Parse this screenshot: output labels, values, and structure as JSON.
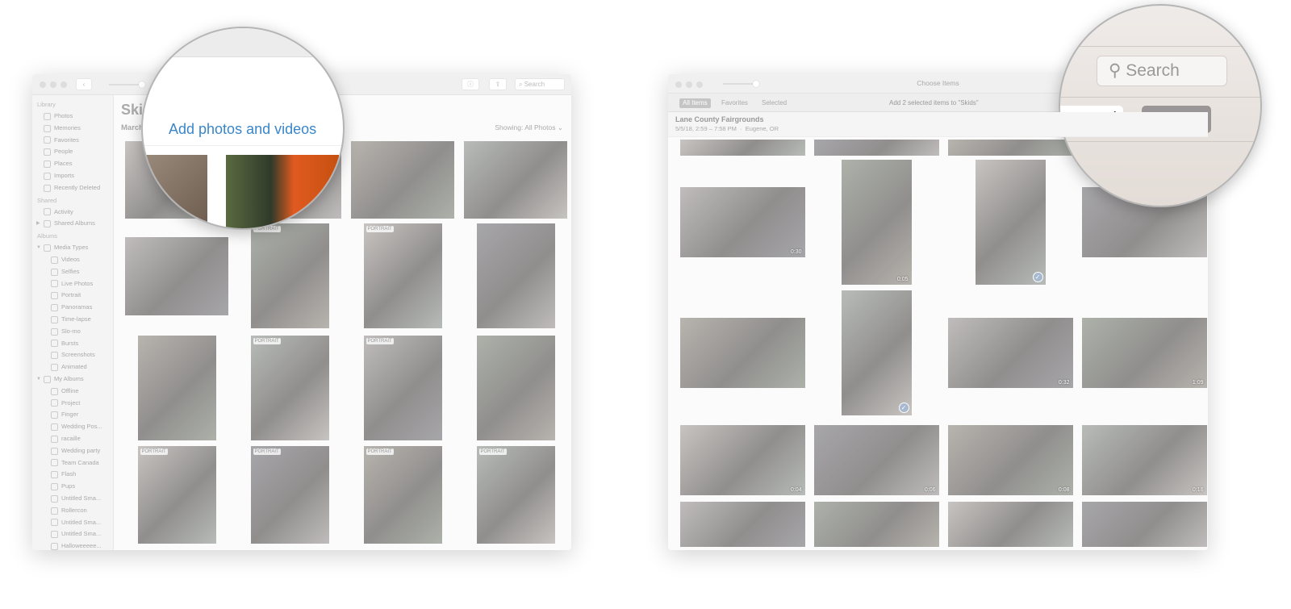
{
  "left_window": {
    "toolbar": {
      "search_placeholder": "Search"
    },
    "sidebar": [
      {
        "section": "Library",
        "items": [
          {
            "label": "Photos",
            "icon": "photos-icon"
          },
          {
            "label": "Memories",
            "icon": "memories-icon"
          },
          {
            "label": "Favorites",
            "icon": "heart-icon"
          },
          {
            "label": "People",
            "icon": "person-icon"
          },
          {
            "label": "Places",
            "icon": "pin-icon"
          },
          {
            "label": "Imports",
            "icon": "clock-icon"
          },
          {
            "label": "Recently Deleted",
            "icon": "trash-icon"
          }
        ]
      },
      {
        "section": "Shared",
        "items": [
          {
            "label": "Activity",
            "icon": "cloud-icon"
          },
          {
            "label": "Shared Albums",
            "icon": "album-icon",
            "disclosure": "closed"
          }
        ]
      },
      {
        "section": "Albums",
        "items": [
          {
            "label": "Media Types",
            "icon": "album-icon",
            "disclosure": "open"
          },
          {
            "label": "Videos",
            "icon": "video-icon",
            "level": 1
          },
          {
            "label": "Selfies",
            "icon": "selfie-icon",
            "level": 1
          },
          {
            "label": "Live Photos",
            "icon": "live-icon",
            "level": 1
          },
          {
            "label": "Portrait",
            "icon": "cube-icon",
            "level": 1
          },
          {
            "label": "Panoramas",
            "icon": "panorama-icon",
            "level": 1
          },
          {
            "label": "Time-lapse",
            "icon": "timelapse-icon",
            "level": 1
          },
          {
            "label": "Slo-mo",
            "icon": "slomo-icon",
            "level": 1
          },
          {
            "label": "Bursts",
            "icon": "bursts-icon",
            "level": 1
          },
          {
            "label": "Screenshots",
            "icon": "phone-icon",
            "level": 1
          },
          {
            "label": "Animated",
            "icon": "animated-icon",
            "level": 1
          },
          {
            "label": "My Albums",
            "icon": "album-icon",
            "disclosure": "open"
          },
          {
            "label": "Offline",
            "icon": "album-icon",
            "level": 1
          },
          {
            "label": "Project",
            "icon": "album-icon",
            "level": 1
          },
          {
            "label": "Finger",
            "icon": "album-icon",
            "level": 1
          },
          {
            "label": "Wedding Pos...",
            "icon": "album-icon",
            "level": 1
          },
          {
            "label": "racaille",
            "icon": "thumbnail-icon",
            "level": 1
          },
          {
            "label": "Wedding party",
            "icon": "thumbnail-icon",
            "level": 1
          },
          {
            "label": "Team Canada",
            "icon": "album-icon",
            "level": 1
          },
          {
            "label": "Flash",
            "icon": "smart-album-icon",
            "level": 1
          },
          {
            "label": "Pups",
            "icon": "thumbnail-icon",
            "level": 1
          },
          {
            "label": "Untitled Sma...",
            "icon": "smart-album-icon",
            "level": 1
          },
          {
            "label": "Rollercon",
            "icon": "thumbnail-icon",
            "level": 1
          },
          {
            "label": "Untitled Sma...",
            "icon": "smart-album-icon",
            "level": 1
          },
          {
            "label": "Untitled Sma...",
            "icon": "smart-album-icon",
            "level": 1
          },
          {
            "label": "Halloweeeee...",
            "icon": "thumbnail-icon",
            "level": 1
          }
        ]
      }
    ],
    "title": "Skids",
    "subtitle": "March",
    "showing": "Showing: All Photos",
    "magnifier_text": "Add photos and videos",
    "photos": [
      [
        {
          "o": "l"
        },
        {
          "o": "l"
        },
        {
          "o": "l"
        },
        {
          "o": "l"
        }
      ],
      [
        {
          "o": "l"
        },
        {
          "o": "p",
          "badge": "PORTRAIT"
        },
        {
          "o": "p",
          "badge": "PORTRAIT"
        },
        {
          "o": "p"
        }
      ],
      [
        {
          "o": "p"
        },
        {
          "o": "p",
          "badge": "PORTRAIT"
        },
        {
          "o": "p",
          "badge": "PORTRAIT"
        },
        {
          "o": "p"
        }
      ],
      [
        {
          "o": "p",
          "badge": "PORTRAIT"
        },
        {
          "o": "p",
          "badge": "PORTRAIT"
        },
        {
          "o": "p",
          "badge": "PORTRAIT"
        },
        {
          "o": "p",
          "badge": "PORTRAIT"
        }
      ]
    ]
  },
  "right_window": {
    "title": "Choose Items",
    "tabs": [
      "All Items",
      "Favorites",
      "Selected"
    ],
    "status": "Add 2 selected items to \"Skids\"",
    "moment": {
      "title": "Lane County Fairgrounds",
      "subtitle": "5/5/18, 2:59 – 7:58 PM  ·  Eugene, OR"
    },
    "search_placeholder": "Search",
    "cancel_label": "Cancel",
    "cancel_visible": "ancel",
    "add_label": "Add",
    "accent": "#7ba7dc",
    "photos": [
      [
        {
          "o": "l"
        },
        {
          "o": "l"
        },
        {
          "o": "l"
        },
        {
          "o": "l"
        }
      ],
      [
        {
          "o": "l",
          "dur": "0:30"
        },
        {
          "o": "p",
          "dur": "0:05"
        },
        {
          "o": "p",
          "selected": true
        },
        {
          "o": "l"
        }
      ],
      [
        {
          "o": "l"
        },
        {
          "o": "p",
          "selected": true
        },
        {
          "o": "l",
          "dur": "0:32"
        },
        {
          "o": "l",
          "dur": "1:09"
        }
      ],
      [
        {
          "o": "l",
          "dur": "0:04"
        },
        {
          "o": "l",
          "dur": "0:06"
        },
        {
          "o": "l",
          "dur": "0:08"
        },
        {
          "o": "l",
          "dur": "0:16"
        }
      ],
      [
        {
          "o": "l"
        },
        {
          "o": "l"
        },
        {
          "o": "l"
        },
        {
          "o": "l"
        }
      ]
    ]
  }
}
